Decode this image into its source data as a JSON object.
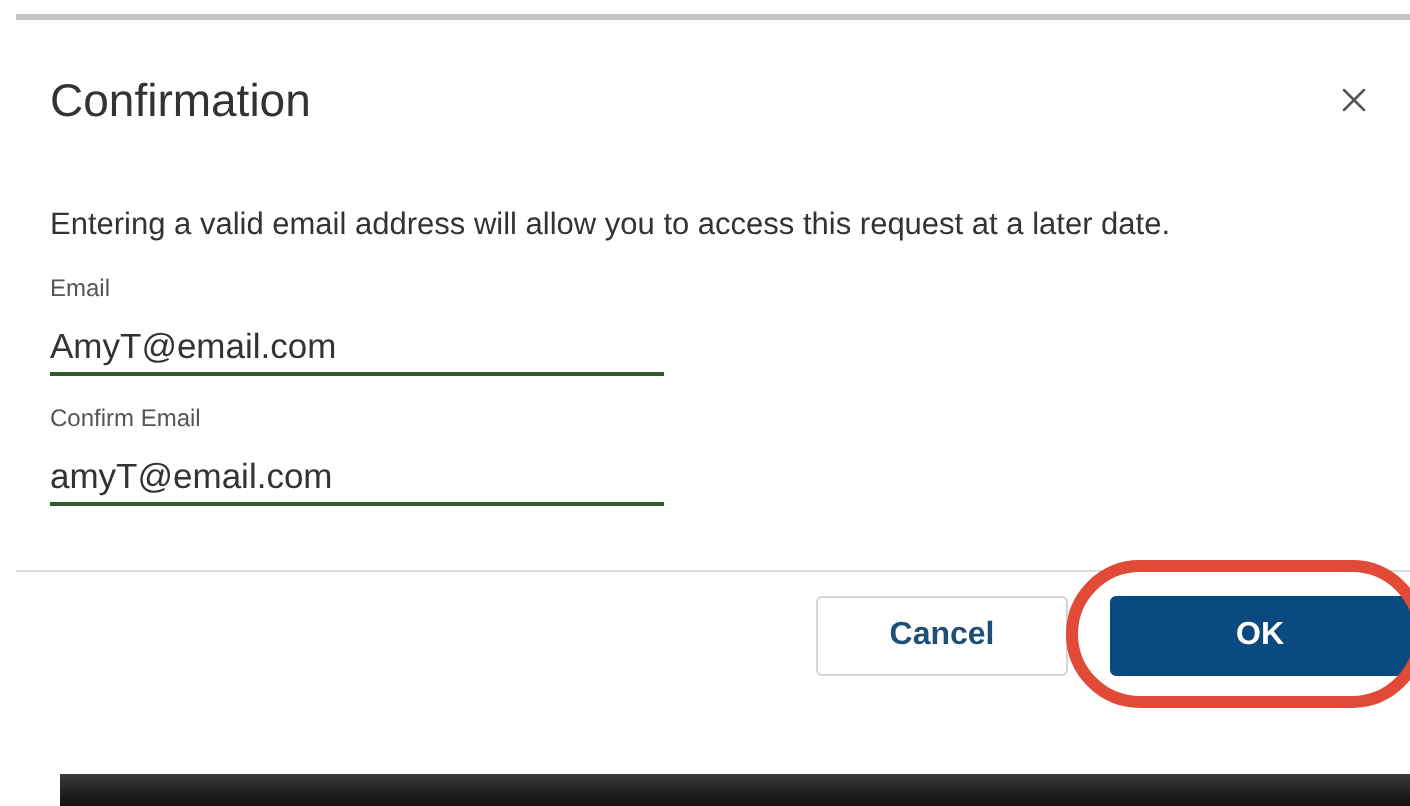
{
  "dialog": {
    "title": "Confirmation",
    "message": "Entering a valid email address will allow you to access this request at a later date.",
    "fields": [
      {
        "label": "Email",
        "value": "AmyT@email.com"
      },
      {
        "label": "Confirm Email",
        "value": "amyT@email.com"
      }
    ],
    "buttons": [
      {
        "label": "Cancel",
        "kind": "secondary",
        "highlighted": false
      },
      {
        "label": "OK",
        "kind": "primary",
        "highlighted": true
      }
    ]
  }
}
